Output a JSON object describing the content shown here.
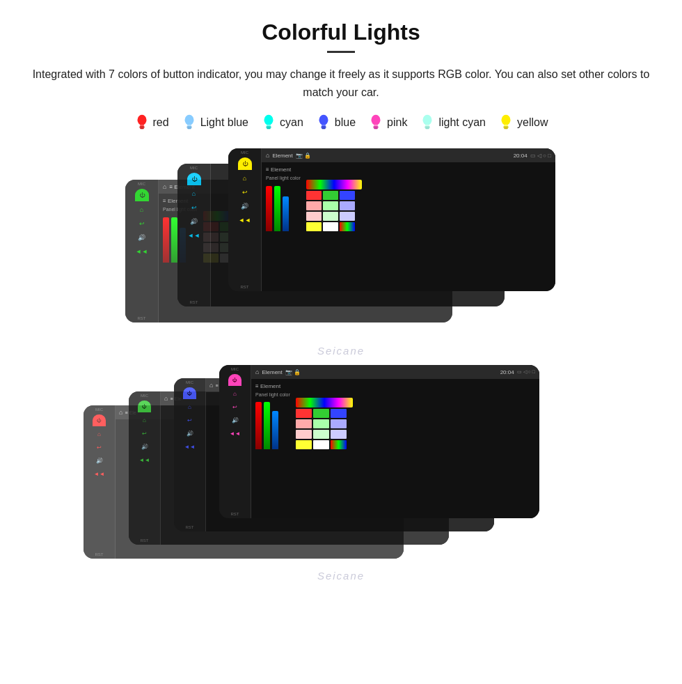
{
  "header": {
    "title": "Colorful Lights",
    "divider": true,
    "description": "Integrated with 7 colors of button indicator, you may change it freely as it supports RGB color. You can also set other colors to match your car."
  },
  "colors": [
    {
      "name": "red",
      "color": "#ff2222",
      "icon": "💡"
    },
    {
      "name": "Light blue",
      "color": "#88ccff",
      "icon": "💡"
    },
    {
      "name": "cyan",
      "color": "#00ffee",
      "icon": "💡"
    },
    {
      "name": "blue",
      "color": "#4455ff",
      "icon": "💡"
    },
    {
      "name": "pink",
      "color": "#ff44bb",
      "icon": "💡"
    },
    {
      "name": "light cyan",
      "color": "#aaffee",
      "icon": "💡"
    },
    {
      "name": "yellow",
      "color": "#ffee00",
      "icon": "💡"
    }
  ],
  "device": {
    "topbar": {
      "title": "Element",
      "time": "20:04"
    },
    "sidebar_labels": [
      "MIC",
      "RST"
    ],
    "panel_label": "Panel light color"
  },
  "watermark": "Seicane",
  "bottom_colors": {
    "row1": [
      "#ff3333",
      "#33cc33",
      "#3344ff"
    ],
    "row2": [
      "#ff9999",
      "#99ff99",
      "#9999ff"
    ],
    "row3": [
      "#ffbbbb",
      "#bbffbb",
      "#bbbbff"
    ],
    "row4": [
      "#ffff33",
      "#ffffff",
      "#ff44ff"
    ]
  }
}
